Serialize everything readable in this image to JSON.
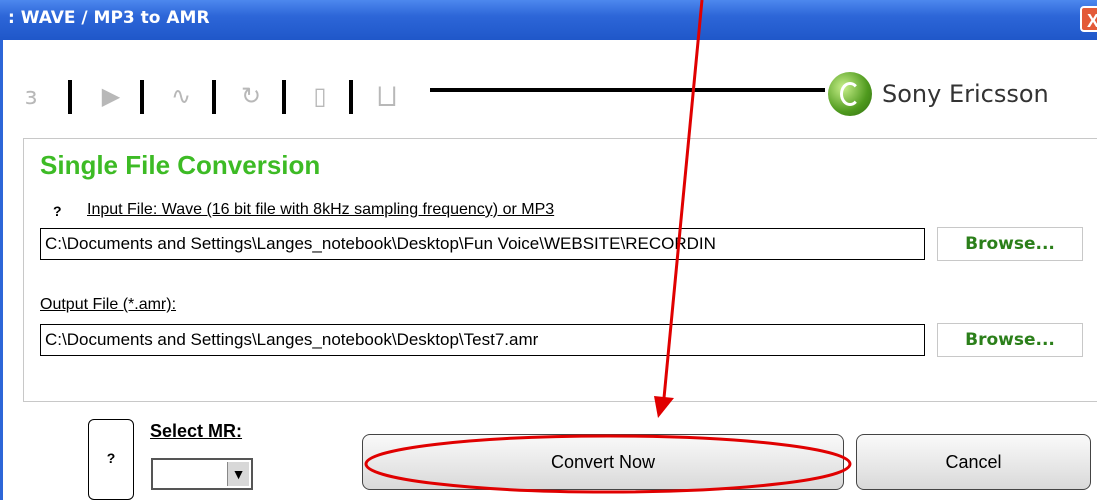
{
  "window": {
    "title": ": WAVE / MP3 to AMR",
    "close_glyph": "X"
  },
  "toolbar": {
    "icons": [
      "ear-icon",
      "play-icon",
      "waveform-icon",
      "convert-icon",
      "phone-icon",
      "transfer-icon"
    ],
    "glyphs": [
      "з",
      "▶",
      "∿",
      "↻",
      "▯",
      "⨆"
    ]
  },
  "brand": {
    "name": "Sony Ericsson"
  },
  "section": {
    "title": "Single File Conversion",
    "help_glyph": "?",
    "input_label": "Input File: Wave (16 bit  file with 8kHz sampling frequency) or MP3",
    "input_value": "C:\\Documents and Settings\\Langes_notebook\\Desktop\\Fun Voice\\WEBSITE\\RECORDIN",
    "output_label": "Output File (*.amr):",
    "output_value": "C:\\Documents and Settings\\Langes_notebook\\Desktop\\Test7.amr",
    "browse_label": "Browse..."
  },
  "footer": {
    "help_glyph": "?",
    "select_label": "Select MR:",
    "select_value": "",
    "convert_label": "Convert Now",
    "cancel_label": "Cancel"
  },
  "colors": {
    "title_bar": "#2d66d8",
    "section_title": "#3dbb25",
    "browse_text": "#2b7f1a",
    "annotation": "#e00000"
  }
}
